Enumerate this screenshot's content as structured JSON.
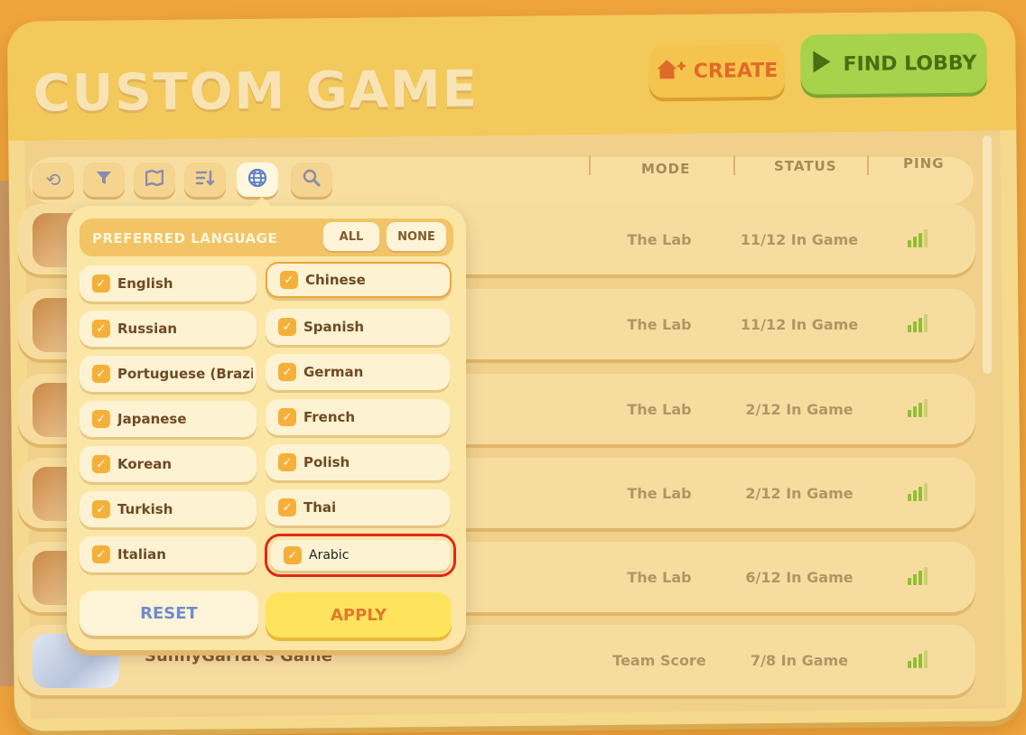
{
  "title": "CUSTOM GAME",
  "header": {
    "create_label": "CREATE",
    "find_lobby_label": "FIND LOBBY"
  },
  "toolbar": {
    "tools": [
      {
        "name": "refresh-icon",
        "glyph": "⟲"
      },
      {
        "name": "filter-icon",
        "glyph": "▼"
      },
      {
        "name": "map-icon",
        "glyph": "▥"
      },
      {
        "name": "sort-icon",
        "glyph": "⇅"
      },
      {
        "name": "globe-icon",
        "glyph": "◍"
      },
      {
        "name": "search-icon",
        "glyph": "⌕"
      }
    ]
  },
  "columns": {
    "mode": "MODE",
    "status": "STATUS",
    "ping": "PING"
  },
  "lobbies": [
    {
      "name": "",
      "mode": "The Lab",
      "status": "11/12 In Game"
    },
    {
      "name": "",
      "mode": "The Lab",
      "status": "11/12 In Game"
    },
    {
      "name": "",
      "mode": "The Lab",
      "status": "2/12 In Game"
    },
    {
      "name": "",
      "mode": "The Lab",
      "status": "2/12 In Game"
    },
    {
      "name": "",
      "mode": "The Lab",
      "status": "6/12 In Game"
    },
    {
      "name": "SunnyGarfat's Game",
      "mode": "Team Score",
      "status": "7/8 In Game"
    }
  ],
  "language_popup": {
    "title": "PREFERRED LANGUAGE",
    "all_label": "ALL",
    "none_label": "NONE",
    "languages": [
      {
        "label": "English",
        "checked": true
      },
      {
        "label": "Chinese",
        "checked": true
      },
      {
        "label": "Russian",
        "checked": true
      },
      {
        "label": "Spanish",
        "checked": true
      },
      {
        "label": "Portuguese (Brazil)",
        "checked": true
      },
      {
        "label": "German",
        "checked": true
      },
      {
        "label": "Japanese",
        "checked": true
      },
      {
        "label": "French",
        "checked": true
      },
      {
        "label": "Korean",
        "checked": true
      },
      {
        "label": "Polish",
        "checked": true
      },
      {
        "label": "Turkish",
        "checked": true
      },
      {
        "label": "Thai",
        "checked": true
      },
      {
        "label": "Italian",
        "checked": true
      },
      {
        "label": "Arabic",
        "checked": true
      }
    ],
    "reset_label": "RESET",
    "apply_label": "APPLY"
  },
  "colors": {
    "background": "#f0a53c",
    "panel": "#f5d98c",
    "accent_green": "#a6d24c",
    "accent_orange": "#e06a2a",
    "highlight": "#e0261f"
  }
}
